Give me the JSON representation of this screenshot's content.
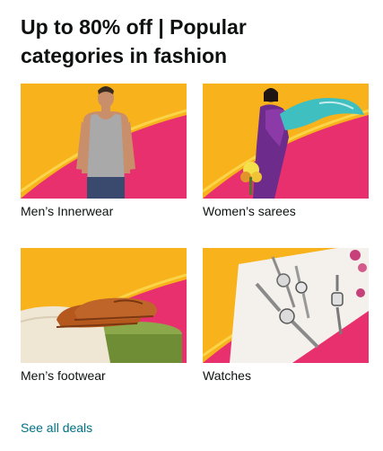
{
  "card": {
    "title": "Up to 80% off | Popular categories in fashion",
    "tiles": [
      {
        "label": "Men’s Innerwear",
        "icon": "mens-innerwear-image"
      },
      {
        "label": "Women’s sarees",
        "icon": "womens-sarees-image"
      },
      {
        "label": "Men’s footwear",
        "icon": "mens-footwear-image"
      },
      {
        "label": "Watches",
        "icon": "watches-image"
      }
    ],
    "see_all": "See all deals"
  },
  "colors": {
    "banner_yellow": "#f7b21c",
    "banner_pink": "#e8306e",
    "link": "#007185",
    "text": "#0f1111"
  }
}
